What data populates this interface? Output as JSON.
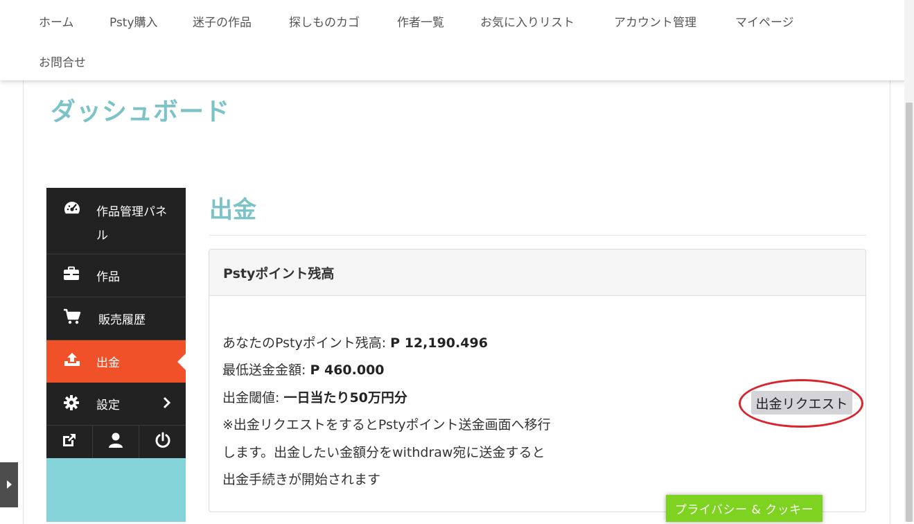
{
  "nav": {
    "items": [
      "ホーム",
      "Psty購入",
      "迷子の作品",
      "探しものカゴ",
      "作者一覧",
      "お気に入りリスト",
      "アカウント管理",
      "マイページ"
    ],
    "second_row": "お問合せ"
  },
  "page_title": "ダッシュボード",
  "sidebar": {
    "items": [
      {
        "label": "作品管理パネル",
        "icon": "dashboard-icon"
      },
      {
        "label": "作品",
        "icon": "briefcase-icon"
      },
      {
        "label": "販売履歴",
        "icon": "cart-icon"
      },
      {
        "label": "出金",
        "icon": "upload-icon"
      },
      {
        "label": "設定",
        "icon": "gear-icon"
      }
    ],
    "active_index": 3,
    "bottom_icons": [
      "external-link-icon",
      "user-icon",
      "power-icon"
    ]
  },
  "main": {
    "title": "出金",
    "panel_title": "Pstyポイント残高",
    "balance_label": "あなたのPstyポイント残高: ",
    "balance_value": "P 12,190.496",
    "min_label": "最低送金金額: ",
    "min_value": "P 460.000",
    "threshold_label": "出金閾値: ",
    "threshold_value": "一日当たり50万円分",
    "note_lines": [
      "※出金リクエストをするとPstyポイント送金画面へ移行",
      "します。出金したい金額分をwithdraw宛に送金すると",
      "出金手続きが開始されます"
    ],
    "request_button": "出金リクエスト"
  },
  "privacy_button": "プライバシー & クッキー",
  "colors": {
    "accent_teal": "#7cc3c8",
    "active_orange": "#f05129",
    "sidebar_dark": "#222222",
    "privacy_green": "#7ed321",
    "highlight_red": "#d9232d"
  }
}
